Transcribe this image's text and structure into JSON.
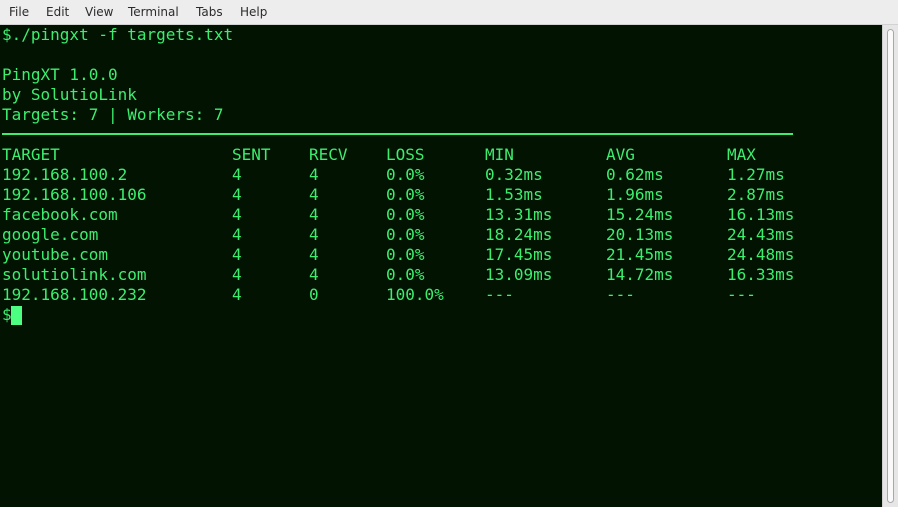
{
  "menu": {
    "items": [
      {
        "label": "File"
      },
      {
        "label": "Edit"
      },
      {
        "label": "View"
      },
      {
        "label": "Terminal"
      },
      {
        "label": "Tabs"
      },
      {
        "label": "Help"
      }
    ]
  },
  "terminal": {
    "command": "$./pingxt -f targets.txt",
    "banner": {
      "title": "PingXT 1.0.0",
      "author": "by SolutioLink",
      "summary": "Targets: 7 | Workers: 7"
    },
    "table": {
      "headers": [
        "TARGET",
        "SENT",
        "RECV",
        "LOSS",
        "MIN",
        "AVG",
        "MAX"
      ],
      "rows": [
        [
          "192.168.100.2",
          "4",
          "4",
          "0.0%",
          "0.32ms",
          "0.62ms",
          "1.27ms"
        ],
        [
          "192.168.100.106",
          "4",
          "4",
          "0.0%",
          "1.53ms",
          "1.96ms",
          "2.87ms"
        ],
        [
          "facebook.com",
          "4",
          "4",
          "0.0%",
          "13.31ms",
          "15.24ms",
          "16.13ms"
        ],
        [
          "google.com",
          "4",
          "4",
          "0.0%",
          "18.24ms",
          "20.13ms",
          "24.43ms"
        ],
        [
          "youtube.com",
          "4",
          "4",
          "0.0%",
          "17.45ms",
          "21.45ms",
          "24.48ms"
        ],
        [
          "solutiolink.com",
          "4",
          "4",
          "0.0%",
          "13.09ms",
          "14.72ms",
          "16.33ms"
        ],
        [
          "192.168.100.232",
          "4",
          "0",
          "100.0%",
          "---",
          "---",
          "---"
        ]
      ]
    },
    "prompt": "$"
  },
  "colors": {
    "background": "#021302",
    "text": "#3dee6e",
    "cursor": "#4dff80"
  }
}
